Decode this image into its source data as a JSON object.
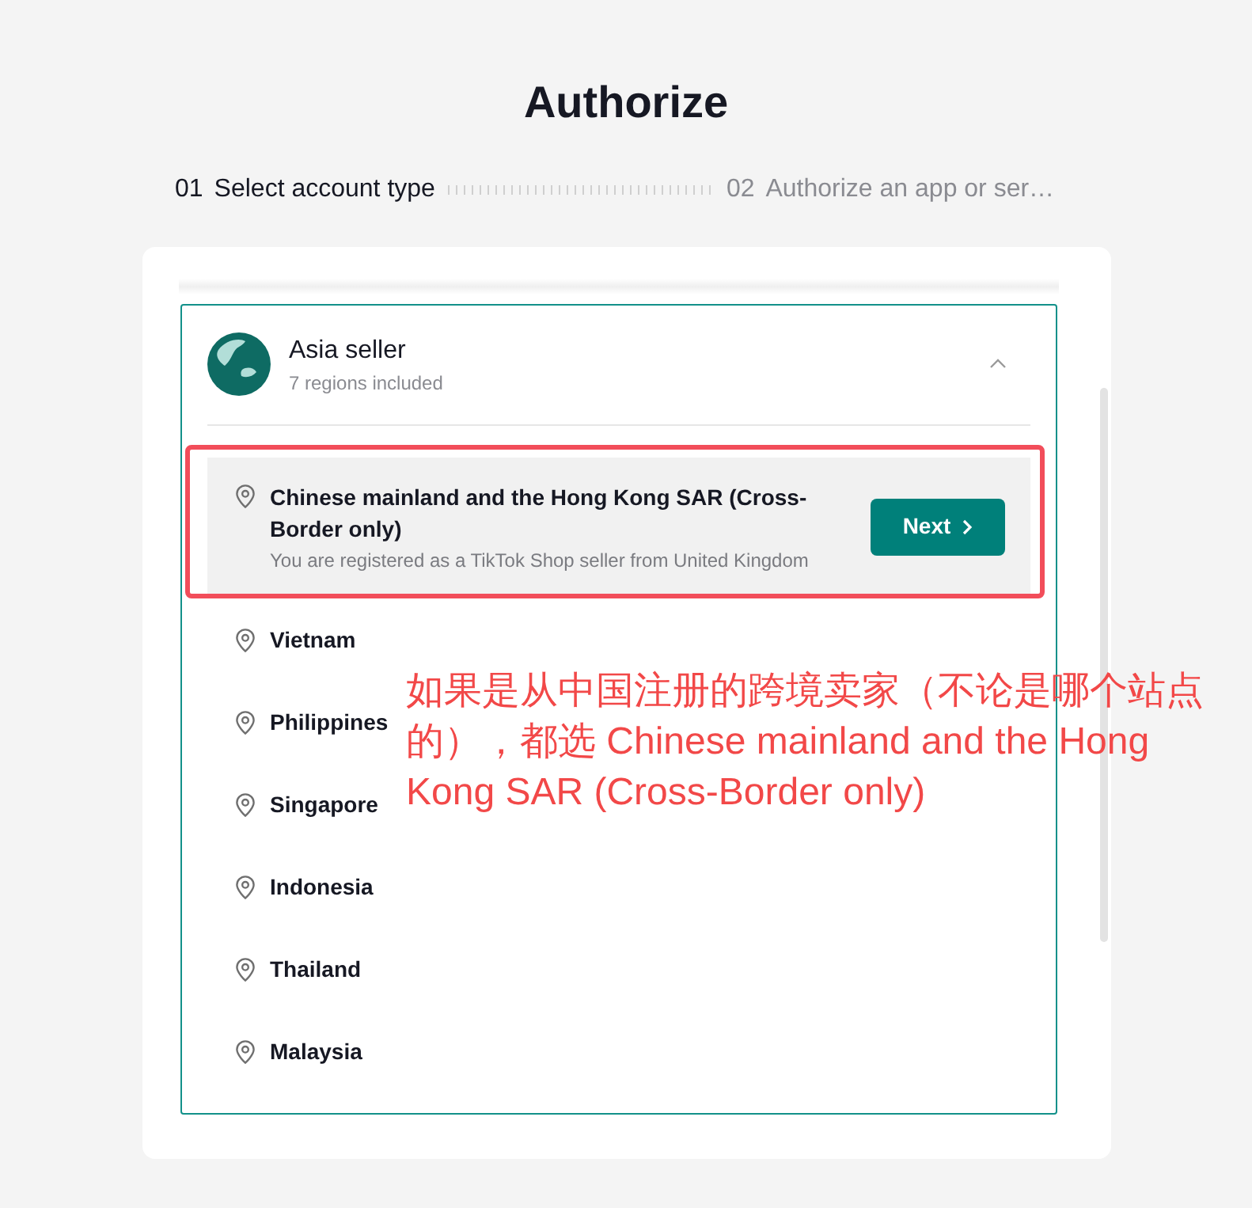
{
  "page": {
    "title": "Authorize"
  },
  "steps": [
    {
      "number": "01",
      "label": "Select account type",
      "selected": true
    },
    {
      "number": "02",
      "label": "Authorize an app or ser…",
      "selected": false
    }
  ],
  "seller_group": {
    "title": "Asia seller",
    "subtitle": "7 regions included",
    "expanded": true,
    "regions": [
      {
        "name": "Chinese mainland and the Hong Kong SAR (Cross-Border only)",
        "note": "You are registered as a TikTok Shop seller from United Kingdom",
        "button": "Next",
        "selected": true,
        "annotated": true
      },
      {
        "name": "Vietnam",
        "selected": false,
        "annotated": false
      },
      {
        "name": "Philippines",
        "selected": false,
        "annotated": false
      },
      {
        "name": "Singapore",
        "selected": false,
        "annotated": false
      },
      {
        "name": "Indonesia",
        "selected": false,
        "annotated": false
      },
      {
        "name": "Thailand",
        "selected": false,
        "annotated": false
      },
      {
        "name": "Malaysia",
        "selected": false,
        "annotated": false
      }
    ]
  },
  "annotation": {
    "text": "如果是从中国注册的跨境卖家（不论是哪个站点的），都选 Chinese mainland and the Hong Kong SAR (Cross-Border only)"
  }
}
